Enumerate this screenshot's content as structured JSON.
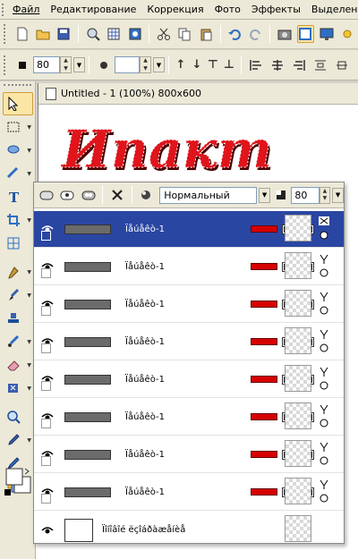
{
  "menu": [
    "Файл",
    "Редактирование",
    "Коррекция",
    "Фото",
    "Эффекты",
    "Выделение"
  ],
  "toolbar1_icons": [
    "new-icon",
    "open-icon",
    "save-icon",
    "browse-icon",
    "grid-icon",
    "photo-icon",
    "cut-icon",
    "copy-icon",
    "paste-icon",
    "undo-icon",
    "redo-icon",
    "camera-icon",
    "frame-icon",
    "monitor-icon",
    "sun-icon"
  ],
  "toolbar2": {
    "opacity_value": "80",
    "arrows": [
      "↑",
      "↓",
      "⊤",
      "⊥"
    ]
  },
  "document": {
    "title": "Untitled - 1 (100%) 800x600",
    "banner_text": "Ипакт"
  },
  "layers_panel": {
    "blend_mode": "Нормальный",
    "opacity": "80",
    "rows": [
      {
        "name": "Ïåúåêò-1",
        "selected": true
      },
      {
        "name": "Ïåúåêò-1",
        "selected": false
      },
      {
        "name": "Ïåúåêò-1",
        "selected": false
      },
      {
        "name": "Ïåúåêò-1",
        "selected": false
      },
      {
        "name": "Ïåúåêò-1",
        "selected": false
      },
      {
        "name": "Ïåúåêò-1",
        "selected": false
      },
      {
        "name": "Ïåúåêò-1",
        "selected": false
      },
      {
        "name": "Ïåúåêò-1",
        "selected": false
      }
    ],
    "background_layer": "Ïîíîâîé ëçîáðàæåíèå"
  },
  "colors": {
    "selected_row": "#2a46a3",
    "banner_red": "#e0141b",
    "chrome": "#ece9d8"
  }
}
